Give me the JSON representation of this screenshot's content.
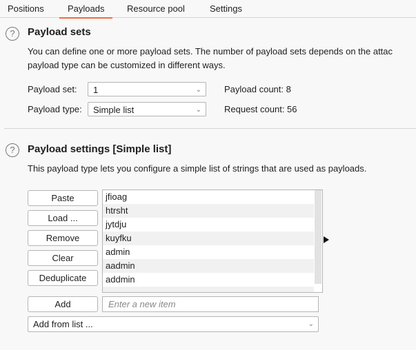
{
  "tabs": [
    {
      "label": "Positions"
    },
    {
      "label": "Payloads",
      "active": true
    },
    {
      "label": "Resource pool"
    },
    {
      "label": "Settings"
    }
  ],
  "payload_sets": {
    "title": "Payload sets",
    "desc_line1": "You can define one or more payload sets. The number of payload sets depends on the attac",
    "desc_line2": "payload type can be customized in different ways.",
    "set_label": "Payload set:",
    "set_value": "1",
    "type_label": "Payload type:",
    "type_value": "Simple list",
    "payload_count": "Payload count: 8",
    "request_count": "Request count: 56"
  },
  "payload_settings": {
    "title": "Payload settings [Simple list]",
    "desc": "This payload type lets you configure a simple list of strings that are used as payloads.",
    "buttons": {
      "paste": "Paste",
      "load": "Load ...",
      "remove": "Remove",
      "clear": "Clear",
      "deduplicate": "Deduplicate",
      "add": "Add"
    },
    "items": [
      "jfioag",
      "htrsht",
      "jytdju",
      "kuyfku",
      "admin",
      "aadmin",
      "addmin",
      ""
    ],
    "new_item_placeholder": "Enter a new item",
    "add_from_list": "Add from list ..."
  },
  "colors": {
    "accent": "#f26a3a"
  }
}
